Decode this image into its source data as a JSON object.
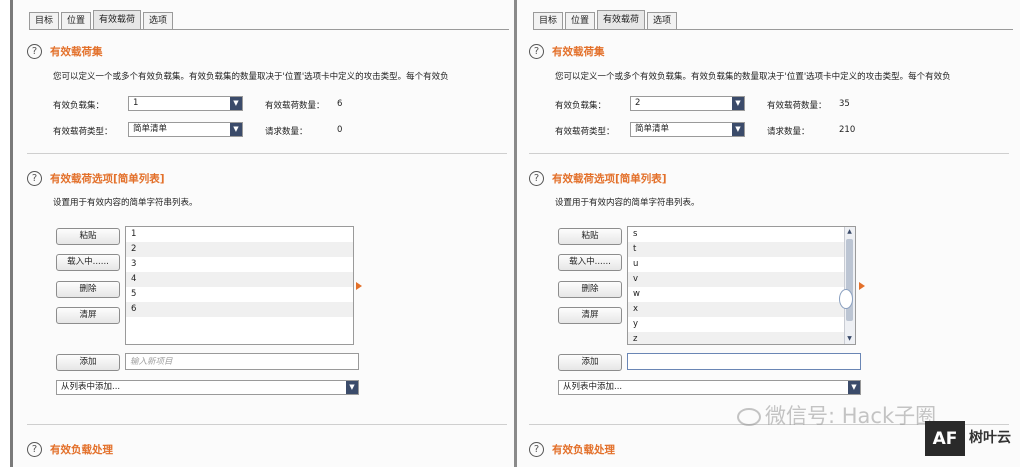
{
  "tabs": [
    "目标",
    "位置",
    "有效载荷",
    "选项"
  ],
  "sections": {
    "payload_sets": {
      "title": "有效载荷集",
      "description": "您可以定义一个或多个有效负载集。有效负载集的数量取决于'位置'选项卡中定义的攻击类型。每个有效负",
      "set_label": "有效负载集：",
      "type_label": "有效载荷类型：",
      "count_label": "有效载荷数量：",
      "request_label": "请求数量："
    },
    "payload_options": {
      "title": "有效载荷选项[简单列表]",
      "description": "设置用于有效内容的简单字符串列表。",
      "buttons": {
        "paste": "粘贴",
        "load": "载入中......",
        "remove": "删除",
        "clear": "清屏",
        "add": "添加"
      },
      "add_placeholder": "输入新项目",
      "add_from_list": "从列表中添加..."
    },
    "payload_processing": {
      "title": "有效负载处理"
    }
  },
  "left": {
    "payload_set": "1",
    "payload_type": "简单清单",
    "payload_count": "6",
    "request_count": "0",
    "list_items": [
      "1",
      "2",
      "3",
      "4",
      "5",
      "6"
    ]
  },
  "right": {
    "payload_set": "2",
    "payload_type": "简单清单",
    "payload_count": "35",
    "request_count": "210",
    "list_items": [
      "s",
      "t",
      "u",
      "v",
      "w",
      "x",
      "y",
      "z"
    ]
  },
  "watermark": "微信号: Hack子圈",
  "logo": {
    "mark": "AF",
    "text": "树叶云"
  }
}
